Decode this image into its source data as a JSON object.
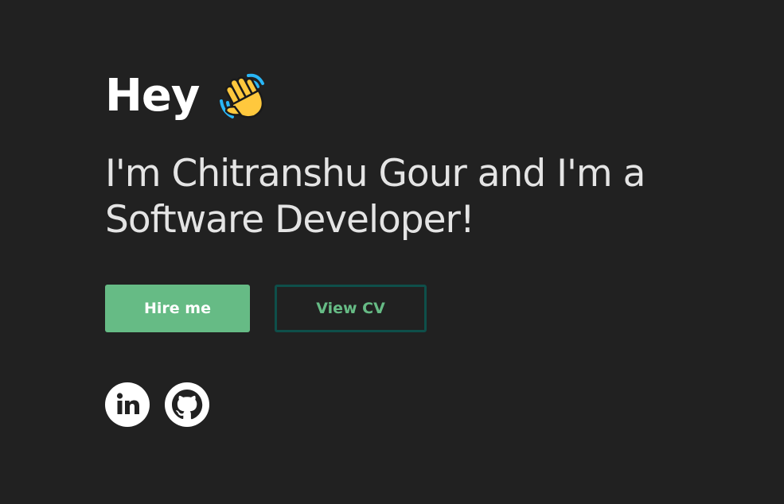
{
  "hero": {
    "greeting": "Hey",
    "greeting_icon": "waving-hand-icon",
    "intro_line1": "I'm Chitranshu Gour and I'm a",
    "intro_line2": "Software Developer!"
  },
  "buttons": {
    "hire_label": "Hire me",
    "cv_label": "View CV"
  },
  "socials": [
    {
      "icon": "linkedin-icon"
    },
    {
      "icon": "github-icon"
    }
  ],
  "colors": {
    "background": "#212121",
    "accent_green": "#66bb85",
    "outline_border": "#0e4f4a",
    "text_primary": "#ffffff",
    "text_secondary": "#e4e4e4"
  }
}
